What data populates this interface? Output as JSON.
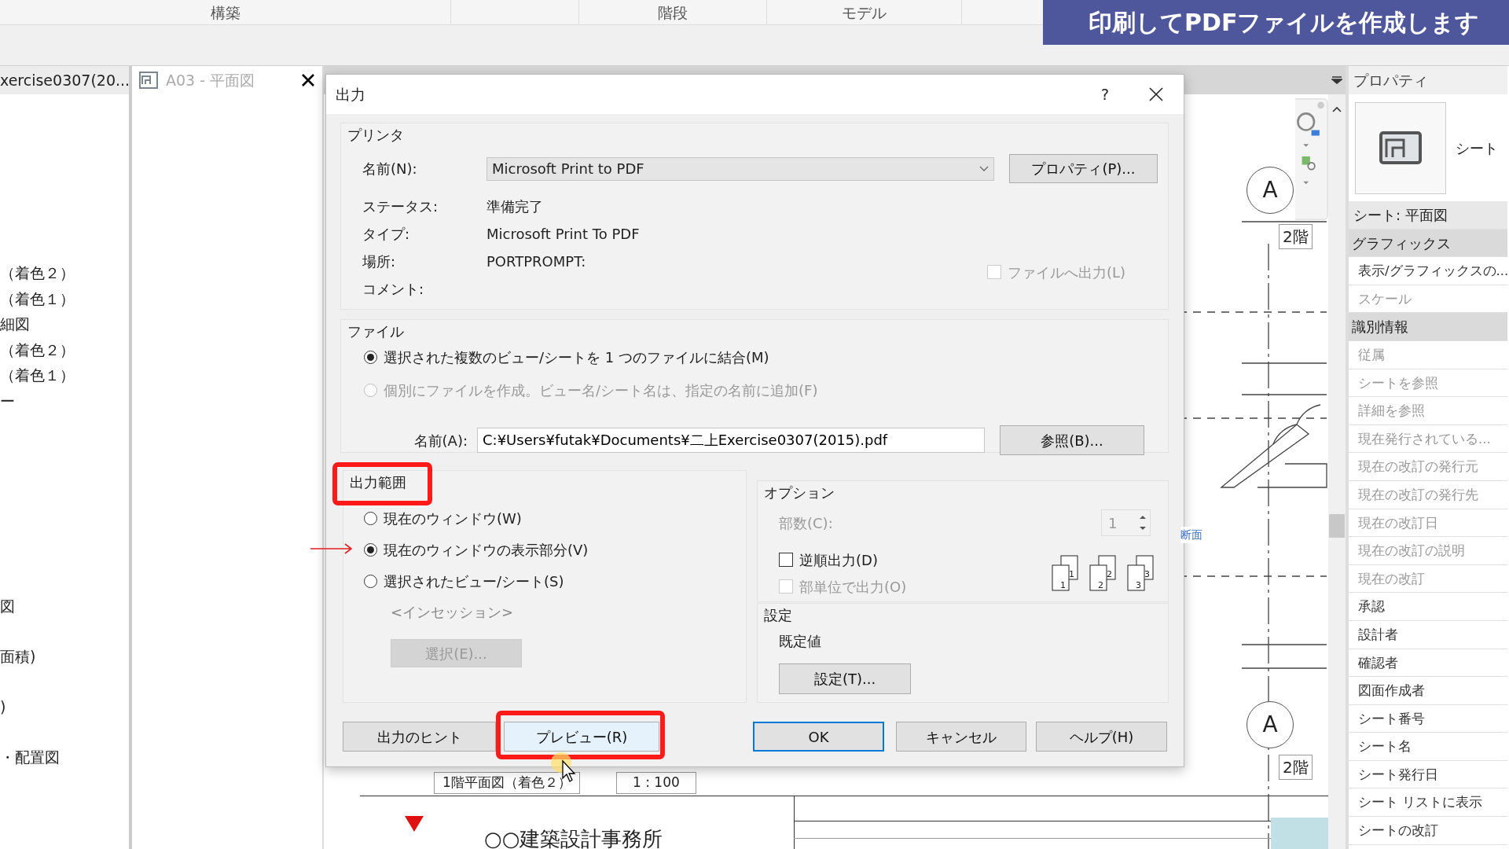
{
  "ribbon_tabs": [
    {
      "label": "構築"
    },
    {
      "label": "階段"
    },
    {
      "label": "モデル"
    }
  ],
  "banner": {
    "text": "印刷してPDFファイルを作成します"
  },
  "project_browser": {
    "tab": "xercise0307(20...",
    "items": [
      "（着色２）",
      "（着色１）",
      "細図",
      "（着色２）",
      "（着色１）",
      "ー"
    ],
    "lower_items": [
      "図",
      "面積)",
      ")",
      "・配置図"
    ]
  },
  "view_tab": {
    "label": "A03 - 平面図"
  },
  "dialog": {
    "title": "出力",
    "help": "?",
    "printer": {
      "label": "プリンタ",
      "name_label": "名前(N):",
      "name_value": "Microsoft Print to PDF",
      "properties_button": "プロパティ(P)...",
      "info": [
        {
          "label": "ステータス:",
          "value": "準備完了"
        },
        {
          "label": "タイプ:",
          "value": "Microsoft Print To PDF"
        },
        {
          "label": "場所:",
          "value": "PORTPROMPT:"
        },
        {
          "label": "コメント:"
        }
      ],
      "print_to_file": {
        "label": "ファイルへ出力(L)",
        "checked": false,
        "disabled": true
      }
    },
    "file": {
      "label": "ファイル",
      "options": [
        {
          "label": "選択された複数のビュー/シートを 1 つのファイルに結合(M)",
          "selected": true,
          "disabled": false
        },
        {
          "label": "個別にファイルを作成。ビュー名/シート名は、指定の名前に追加(F)",
          "selected": false,
          "disabled": true
        }
      ],
      "name_label": "名前(A):",
      "name_value": "C:¥Users¥futak¥Documents¥二上Exercise0307(2015).pdf",
      "browse_button": "参照(B)..."
    },
    "print_range": {
      "label": "出力範囲",
      "highlighted": true,
      "options": [
        {
          "label": "現在のウィンドウ(W)",
          "selected": false,
          "pointed": false
        },
        {
          "label": "現在のウィンドウの表示部分(V)",
          "selected": true,
          "pointed": true
        },
        {
          "label": "選択されたビュー/シート(S)",
          "selected": false,
          "pointed": false
        }
      ],
      "selection_name": "<インセッション>",
      "select_button": {
        "label": "選択(E)...",
        "disabled": true
      }
    },
    "options": {
      "label": "オプション",
      "copies_label": "部数(C):",
      "copies_value": "1",
      "copies_disabled": true,
      "checks": [
        {
          "label": "逆順出力(D)",
          "checked": false,
          "disabled": false
        },
        {
          "label": "部単位で出力(O)",
          "checked": false,
          "disabled": true
        }
      ],
      "page_icons": [
        {
          "back": "1",
          "front": "1"
        },
        {
          "back": "2",
          "front": "2"
        },
        {
          "back": "3",
          "front": "3"
        }
      ]
    },
    "settings": {
      "label": "設定",
      "value": "既定値",
      "button": "設定(T)..."
    },
    "buttons": [
      {
        "label": "出力のヒント",
        "highlighted": false,
        "default": false
      },
      {
        "label": "プレビュー(R)",
        "highlighted": true,
        "default": false
      },
      {
        "label": "OK",
        "highlighted": false,
        "default": true
      },
      {
        "label": "キャンセル",
        "highlighted": false,
        "default": false
      },
      {
        "label": "ヘルプ(H)",
        "highlighted": false,
        "default": false
      }
    ]
  },
  "sheet": {
    "view_title": "1階平面図（着色２）",
    "scale": "1 : 100",
    "office": "○○建築設計事務所",
    "section_label": "断面",
    "grid_bubbles": [
      "A",
      "A"
    ],
    "level_tags": [
      "2階",
      "2階"
    ]
  },
  "properties": {
    "title": "プロパティ",
    "type_name": "シート",
    "rows": [
      {
        "label": "シート: 平面図",
        "kind": "selector"
      },
      {
        "label": "グラフィックス",
        "kind": "category"
      },
      {
        "label": "表示/グラフィックスの...",
        "kind": "param",
        "disabled": false
      },
      {
        "label": "スケール",
        "kind": "param",
        "disabled": true
      },
      {
        "label": "識別情報",
        "kind": "category"
      },
      {
        "label": "従属",
        "kind": "param",
        "disabled": true
      },
      {
        "label": "シートを参照",
        "kind": "param",
        "disabled": true
      },
      {
        "label": "詳細を参照",
        "kind": "param",
        "disabled": true
      },
      {
        "label": "現在発行されている...",
        "kind": "param",
        "disabled": true
      },
      {
        "label": "現在の改訂の発行元",
        "kind": "param",
        "disabled": true
      },
      {
        "label": "現在の改訂の発行先",
        "kind": "param",
        "disabled": true
      },
      {
        "label": "現在の改訂日",
        "kind": "param",
        "disabled": true
      },
      {
        "label": "現在の改訂の説明",
        "kind": "param",
        "disabled": true
      },
      {
        "label": "現在の改訂",
        "kind": "param",
        "disabled": true
      },
      {
        "label": "承認",
        "kind": "param",
        "disabled": false
      },
      {
        "label": "設計者",
        "kind": "param",
        "disabled": false
      },
      {
        "label": "確認者",
        "kind": "param",
        "disabled": false
      },
      {
        "label": "図面作成者",
        "kind": "param",
        "disabled": false
      },
      {
        "label": "シート番号",
        "kind": "param",
        "disabled": false
      },
      {
        "label": "シート名",
        "kind": "param",
        "disabled": false
      },
      {
        "label": "シート発行日",
        "kind": "param",
        "disabled": false
      },
      {
        "label": "シート リストに表示",
        "kind": "param",
        "disabled": false
      },
      {
        "label": "シートの改訂",
        "kind": "param",
        "disabled": false
      }
    ]
  }
}
